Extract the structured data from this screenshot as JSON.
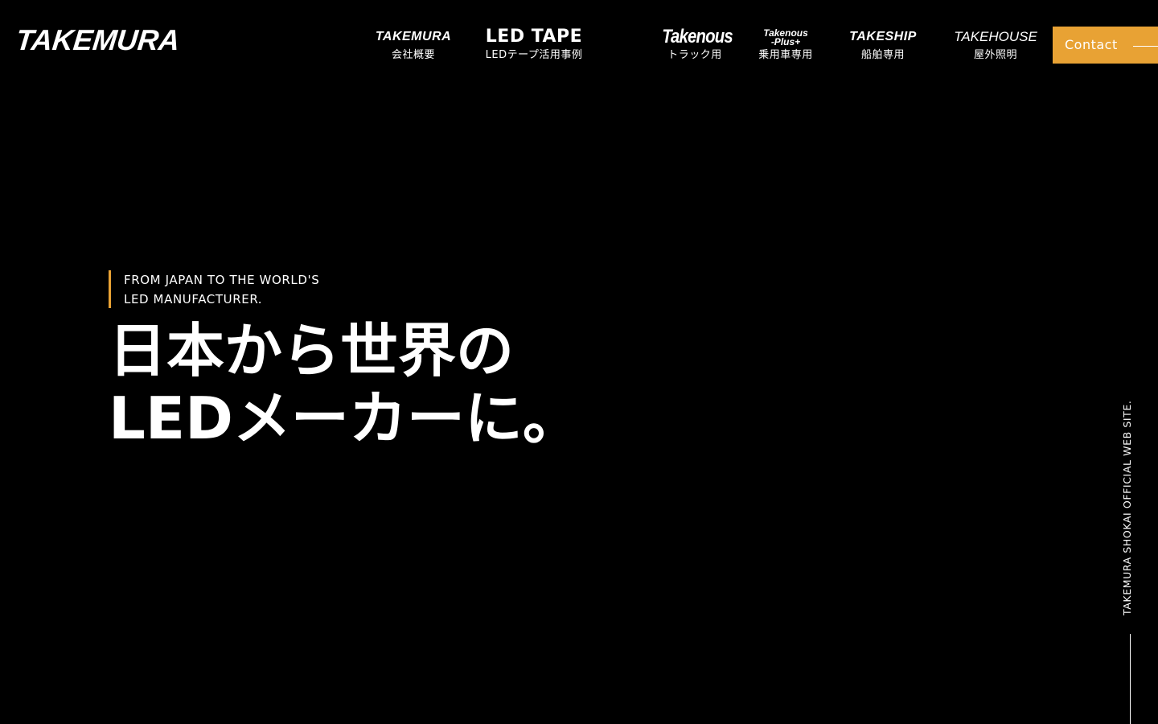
{
  "colors": {
    "background": "#000000",
    "accent": "#E8A234",
    "text": "#FFFFFF"
  },
  "header": {
    "logo": "TAKEMURA",
    "nav": [
      {
        "brand": "TAKEMURA",
        "sub": "会社概要"
      },
      {
        "brand": "LED TAPE",
        "sub": "LEDテープ活用事例"
      },
      {
        "brand": "Takenous",
        "sub": "トラック用"
      },
      {
        "brand_line1": "Takenous",
        "brand_line2": "-Plus+",
        "sub": "乗用車専用"
      },
      {
        "brand": "TAKESHIP",
        "sub": "船舶専用"
      },
      {
        "brand": "TAKEHOUSE",
        "sub": "屋外照明"
      }
    ],
    "contact_label": "Contact"
  },
  "hero": {
    "tagline_line1": "FROM JAPAN TO THE WORLD'S",
    "tagline_line2": "LED MANUFACTURER.",
    "headline_line1": "日本から世界の",
    "headline_line2": "LEDメーカーに。"
  },
  "side": {
    "vertical_text": "TAKEMURA SHOKAI OFFICIAL WEB SITE."
  }
}
